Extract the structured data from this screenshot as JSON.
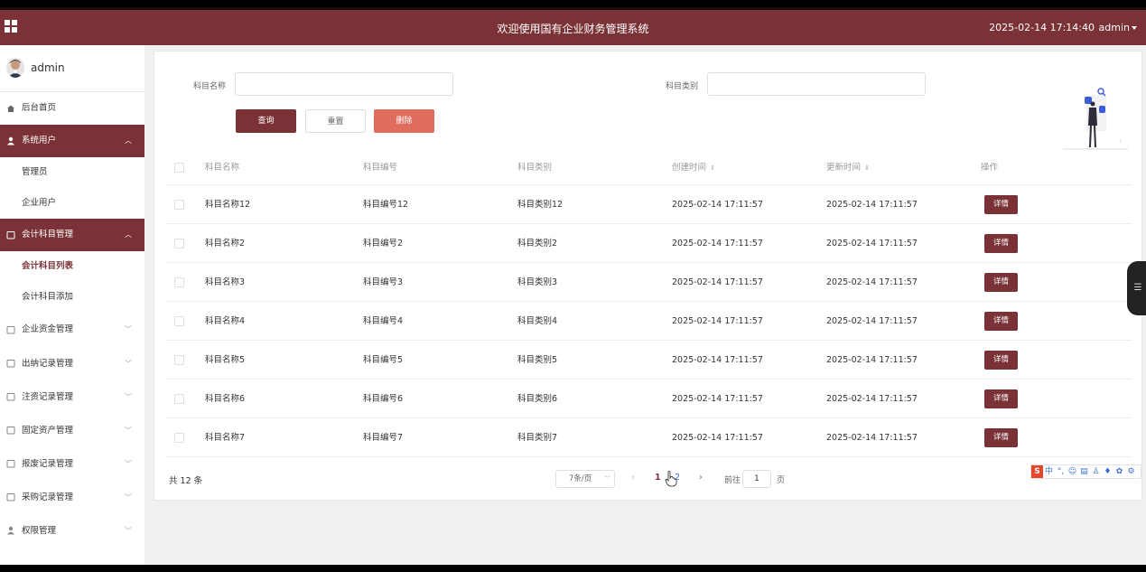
{
  "header": {
    "title": "欢迎使用国有企业财务管理系统",
    "datetime": "2025-02-14 17:14:40",
    "user": "admin"
  },
  "sidebar": {
    "user_name": "admin",
    "items": [
      {
        "label": "后台首页",
        "icon": "home-icon"
      },
      {
        "label": "系统用户",
        "icon": "user-icon",
        "expanded": true,
        "children": [
          {
            "label": "管理员"
          },
          {
            "label": "企业用户"
          }
        ]
      },
      {
        "label": "会计科目管理",
        "icon": "folder-icon",
        "expanded": true,
        "children": [
          {
            "label": "会计科目列表",
            "active": true
          },
          {
            "label": "会计科目添加"
          }
        ]
      },
      {
        "label": "企业资金管理",
        "icon": "folder-icon"
      },
      {
        "label": "出纳记录管理",
        "icon": "folder-icon"
      },
      {
        "label": "注资记录管理",
        "icon": "folder-icon"
      },
      {
        "label": "固定资产管理",
        "icon": "folder-icon"
      },
      {
        "label": "报废记录管理",
        "icon": "folder-icon"
      },
      {
        "label": "采购记录管理",
        "icon": "folder-icon"
      },
      {
        "label": "权限管理",
        "icon": "user-icon"
      }
    ]
  },
  "search": {
    "name_label": "科目名称",
    "name_value": "",
    "category_label": "科目类别",
    "category_value": "",
    "query_btn": "查询",
    "reset_btn": "重置",
    "delete_btn": "删除"
  },
  "table": {
    "columns": [
      "科目名称",
      "科目编号",
      "科目类别",
      "创建时间",
      "更新时间",
      "操作"
    ],
    "rows": [
      {
        "name": "科目名称12",
        "code": "科目编号12",
        "category": "科目类别12",
        "created": "2025-02-14 17:11:57",
        "updated": "2025-02-14 17:11:57",
        "action": "详情"
      },
      {
        "name": "科目名称2",
        "code": "科目编号2",
        "category": "科目类别2",
        "created": "2025-02-14 17:11:57",
        "updated": "2025-02-14 17:11:57",
        "action": "详情"
      },
      {
        "name": "科目名称3",
        "code": "科目编号3",
        "category": "科目类别3",
        "created": "2025-02-14 17:11:57",
        "updated": "2025-02-14 17:11:57",
        "action": "详情"
      },
      {
        "name": "科目名称4",
        "code": "科目编号4",
        "category": "科目类别4",
        "created": "2025-02-14 17:11:57",
        "updated": "2025-02-14 17:11:57",
        "action": "详情"
      },
      {
        "name": "科目名称5",
        "code": "科目编号5",
        "category": "科目类别5",
        "created": "2025-02-14 17:11:57",
        "updated": "2025-02-14 17:11:57",
        "action": "详情"
      },
      {
        "name": "科目名称6",
        "code": "科目编号6",
        "category": "科目类别6",
        "created": "2025-02-14 17:11:57",
        "updated": "2025-02-14 17:11:57",
        "action": "详情"
      },
      {
        "name": "科目名称7",
        "code": "科目编号7",
        "category": "科目类别7",
        "created": "2025-02-14 17:11:57",
        "updated": "2025-02-14 17:11:57",
        "action": "详情"
      }
    ]
  },
  "pager": {
    "total": "共 12 条",
    "page_size": "7条/页",
    "pages": [
      "1",
      "2"
    ],
    "current": "1",
    "goto_label": "前往",
    "goto_value": "1",
    "goto_unit": "页"
  },
  "ime": {
    "items": [
      "中",
      "°,",
      "☺",
      "▤",
      "♙",
      "♦",
      "✿",
      "⚙"
    ]
  },
  "colors": {
    "brand": "#7b3236",
    "danger": "#e06c5e"
  }
}
